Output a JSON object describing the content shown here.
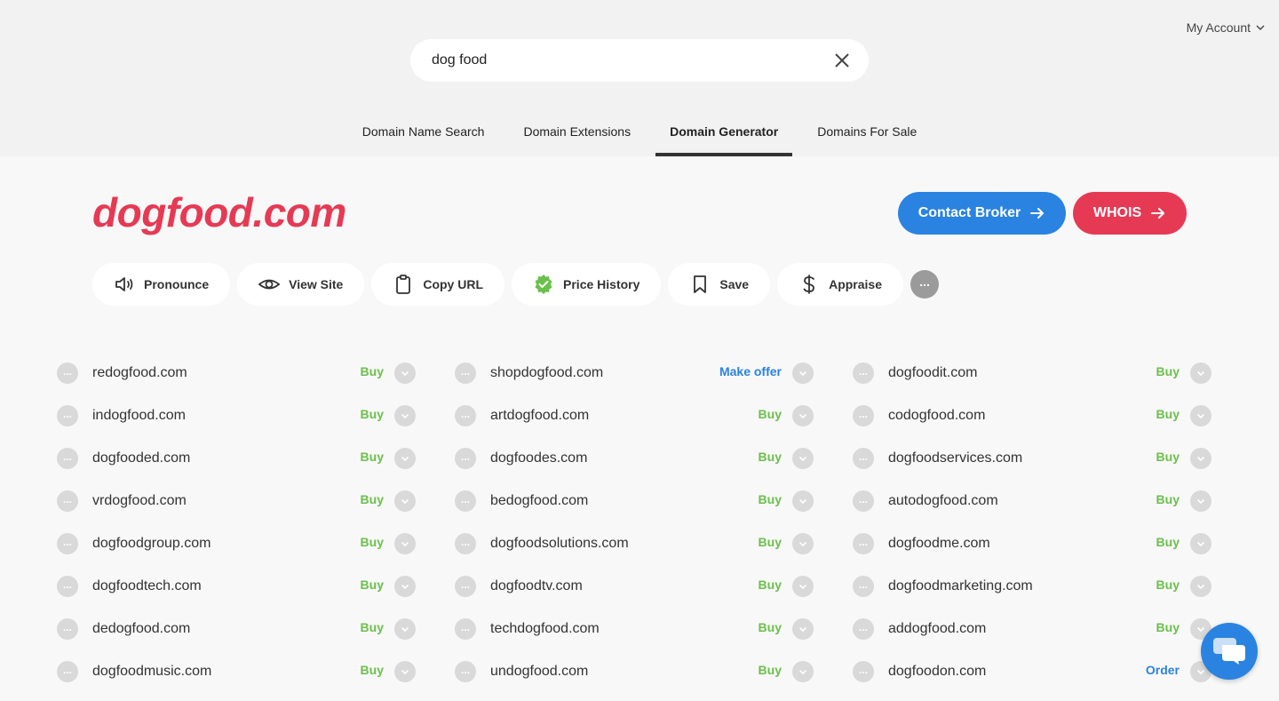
{
  "header": {
    "account_label": "My Account",
    "search_value": "dog food"
  },
  "tabs": [
    {
      "label": "Domain Name Search"
    },
    {
      "label": "Domain Extensions"
    },
    {
      "label": "Domain Generator"
    },
    {
      "label": "Domains For Sale"
    }
  ],
  "domain": {
    "title": "dogfood.com",
    "broker_label": "Contact Broker",
    "whois_label": "WHOIS"
  },
  "actions": {
    "pronounce": "Pronounce",
    "view_site": "View Site",
    "copy_url": "Copy URL",
    "price_history": "Price History",
    "save": "Save",
    "appraise": "Appraise"
  },
  "results": [
    [
      {
        "name": "redogfood.com",
        "action": "Buy"
      },
      {
        "name": "indogfood.com",
        "action": "Buy"
      },
      {
        "name": "dogfooded.com",
        "action": "Buy"
      },
      {
        "name": "vrdogfood.com",
        "action": "Buy"
      },
      {
        "name": "dogfoodgroup.com",
        "action": "Buy"
      },
      {
        "name": "dogfoodtech.com",
        "action": "Buy"
      },
      {
        "name": "dedogfood.com",
        "action": "Buy"
      },
      {
        "name": "dogfoodmusic.com",
        "action": "Buy"
      }
    ],
    [
      {
        "name": "shopdogfood.com",
        "action": "Make offer"
      },
      {
        "name": "artdogfood.com",
        "action": "Buy"
      },
      {
        "name": "dogfoodes.com",
        "action": "Buy"
      },
      {
        "name": "bedogfood.com",
        "action": "Buy"
      },
      {
        "name": "dogfoodsolutions.com",
        "action": "Buy"
      },
      {
        "name": "dogfoodtv.com",
        "action": "Buy"
      },
      {
        "name": "techdogfood.com",
        "action": "Buy"
      },
      {
        "name": "undogfood.com",
        "action": "Buy"
      }
    ],
    [
      {
        "name": "dogfoodit.com",
        "action": "Buy"
      },
      {
        "name": "codogfood.com",
        "action": "Buy"
      },
      {
        "name": "dogfoodservices.com",
        "action": "Buy"
      },
      {
        "name": "autodogfood.com",
        "action": "Buy"
      },
      {
        "name": "dogfoodme.com",
        "action": "Buy"
      },
      {
        "name": "dogfoodmarketing.com",
        "action": "Buy"
      },
      {
        "name": "addogfood.com",
        "action": "Buy"
      },
      {
        "name": "dogfoodon.com",
        "action": "Order"
      }
    ]
  ],
  "colors": {
    "brand_red": "#e63a54",
    "brand_blue": "#2a83e0",
    "buy_green": "#6bc04b"
  }
}
